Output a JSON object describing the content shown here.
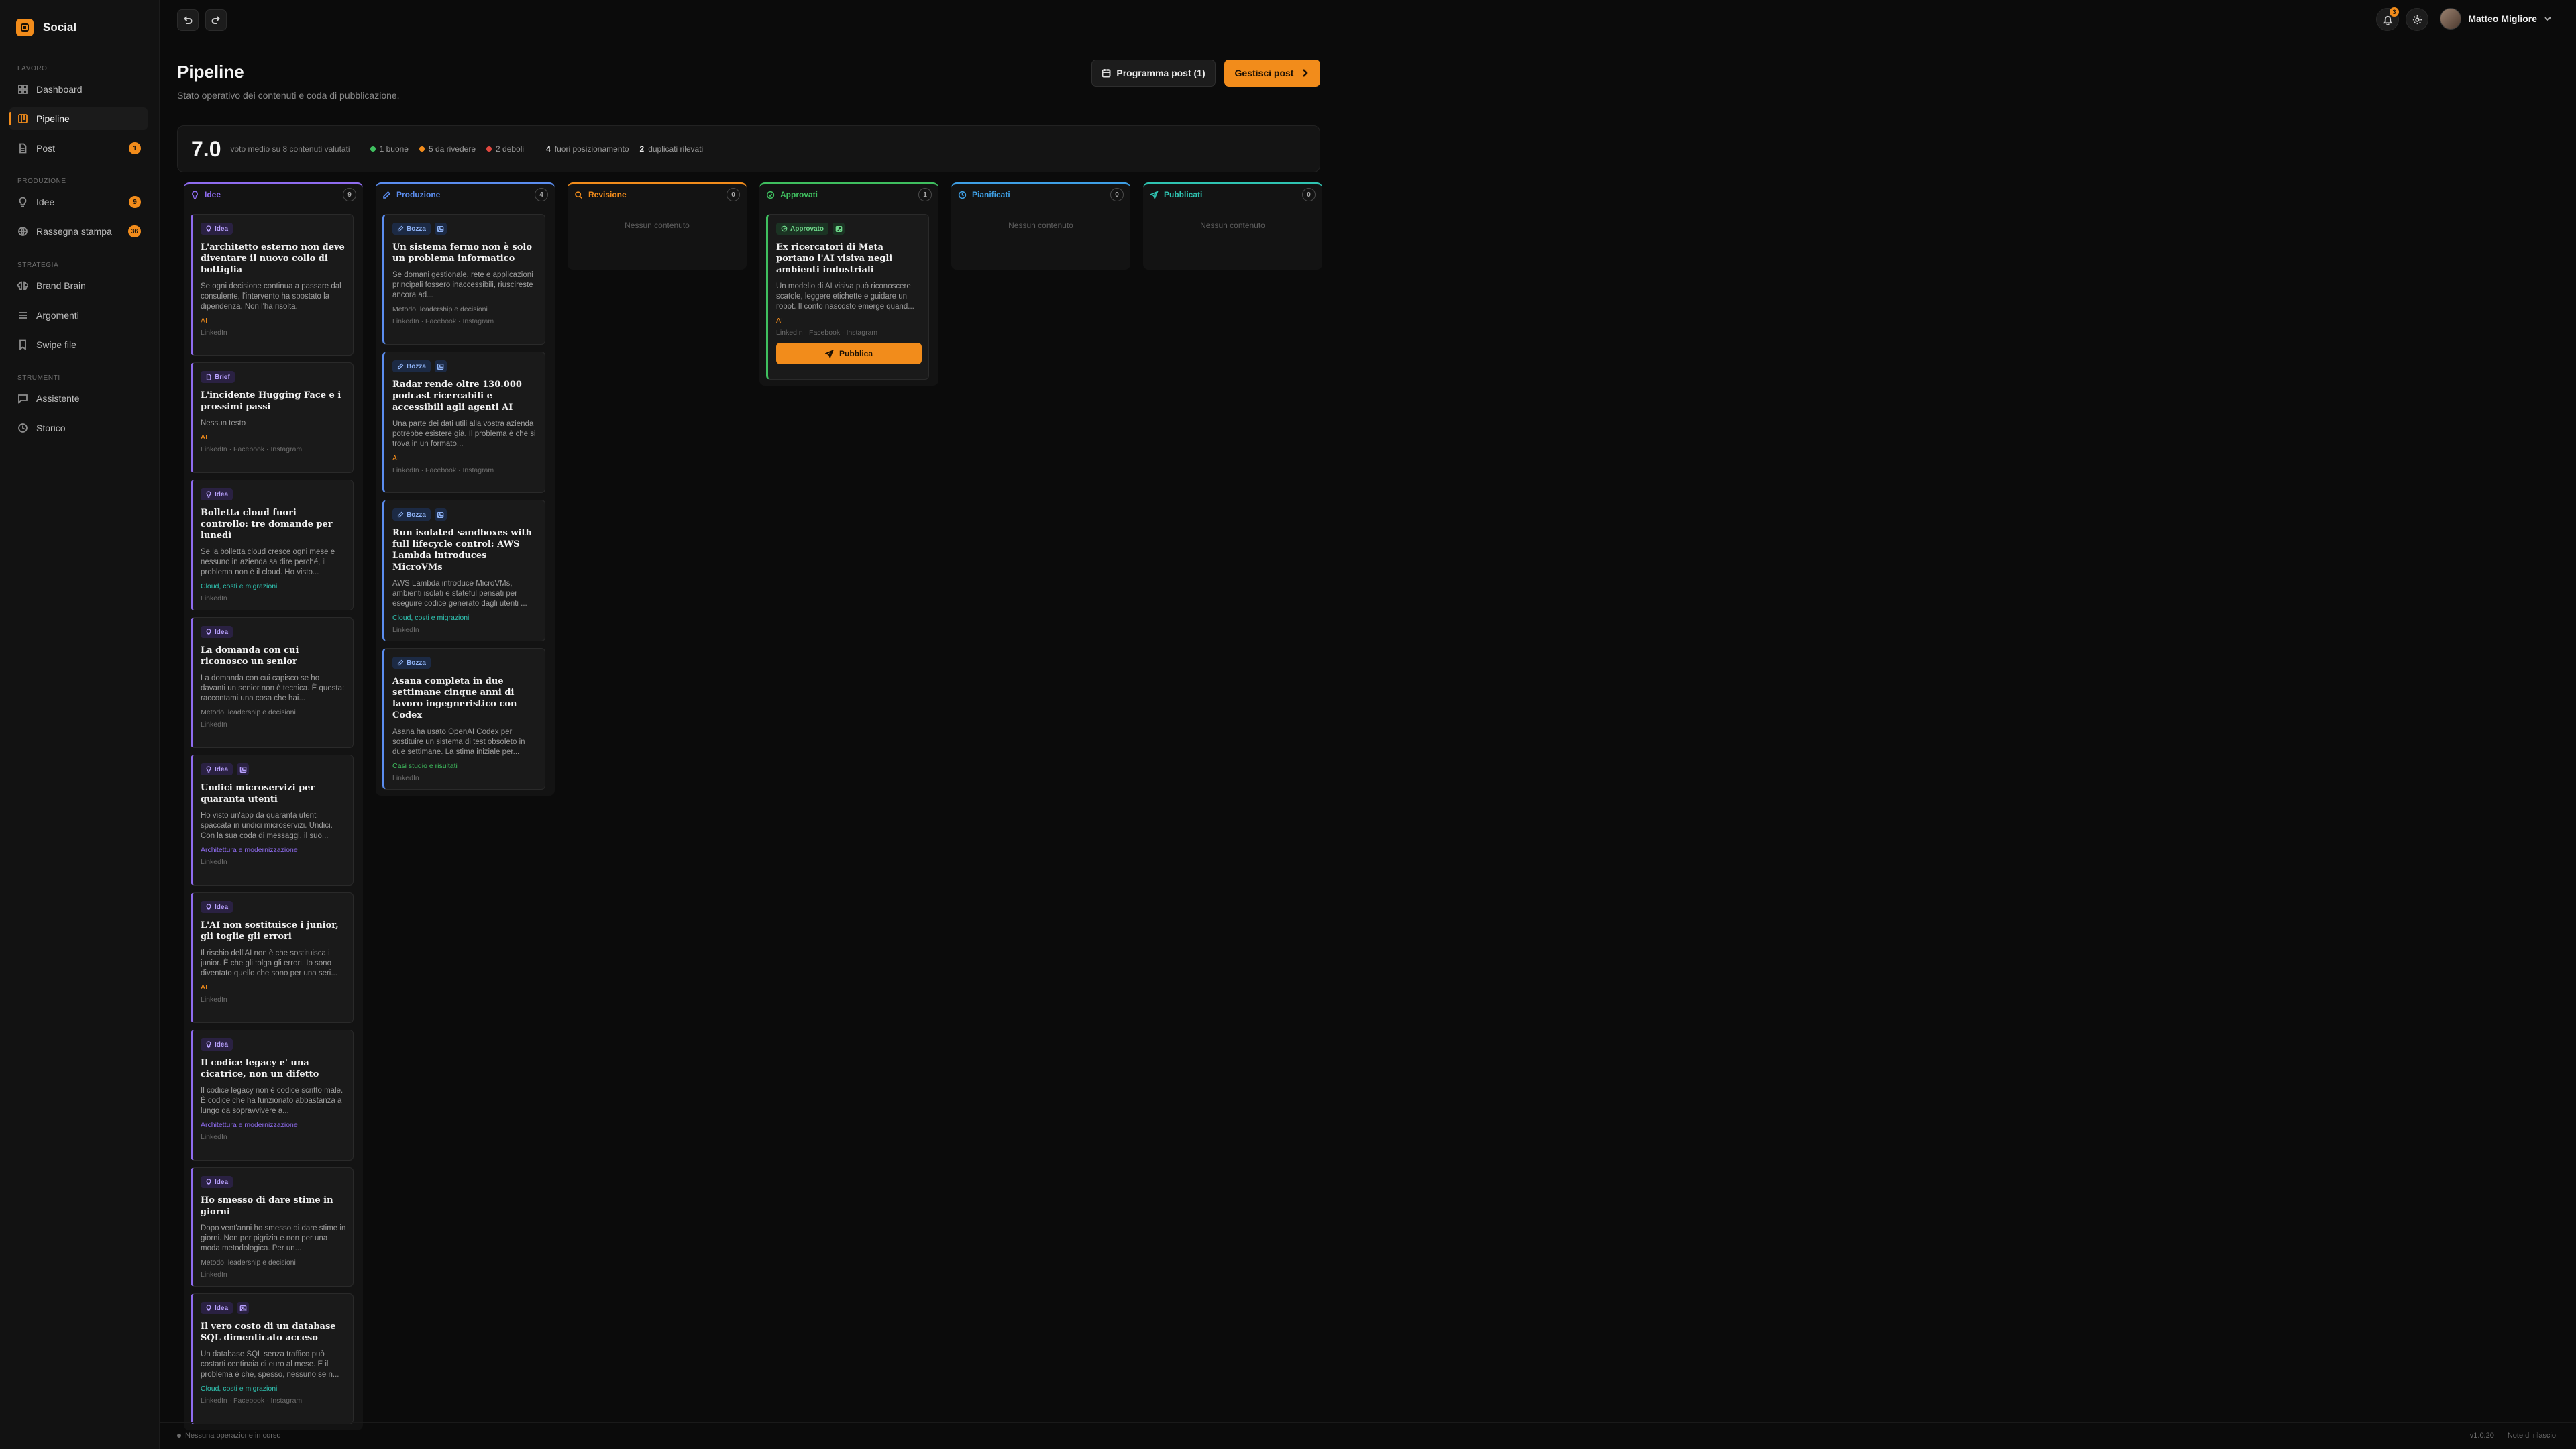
{
  "app": {
    "name": "Social"
  },
  "sidebar": {
    "sections": [
      {
        "title": "LAVORO",
        "items": [
          {
            "label": "Dashboard",
            "icon": "grid-icon",
            "active": false
          },
          {
            "label": "Pipeline",
            "icon": "kanban-icon",
            "active": true
          },
          {
            "label": "Post",
            "icon": "document-icon",
            "active": false,
            "badge": "1"
          }
        ]
      },
      {
        "title": "PRODUZIONE",
        "items": [
          {
            "label": "Idee",
            "icon": "lightbulb-icon",
            "active": false,
            "badge": "9"
          },
          {
            "label": "Rassegna stampa",
            "icon": "globe-icon",
            "active": false,
            "badge": "36"
          }
        ]
      },
      {
        "title": "STRATEGIA",
        "items": [
          {
            "label": "Brand Brain",
            "icon": "brain-icon",
            "active": false
          },
          {
            "label": "Argomenti",
            "icon": "list-icon",
            "active": false
          },
          {
            "label": "Swipe file",
            "icon": "bookmark-icon",
            "active": false
          }
        ]
      },
      {
        "title": "STRUMENTI",
        "items": [
          {
            "label": "Assistente",
            "icon": "chat-icon",
            "active": false
          },
          {
            "label": "Storico",
            "icon": "history-icon",
            "active": false
          }
        ]
      }
    ]
  },
  "topbar": {
    "notifications": "3",
    "user_name": "Matteo Migliore"
  },
  "header": {
    "title": "Pipeline",
    "subtitle": "Stato operativo dei contenuti e coda di pubblicazione.",
    "schedule_label": "Programma post (1)",
    "manage_label": "Gestisci post"
  },
  "stats": {
    "score": "7.0",
    "score_desc": "voto medio su 8 contenuti valutati",
    "good": "1 buone",
    "review": "5 da rivedere",
    "weak": "2 deboli",
    "off_pos_count": "4",
    "off_pos_label": "fuori posizionamento",
    "dup_count": "2",
    "dup_label": "duplicati rilevati",
    "colors": {
      "good": "#3fbf5f",
      "review": "#f28c1b",
      "weak": "#e0473e"
    }
  },
  "columns": [
    {
      "key": "idee",
      "title": "Idee",
      "count": "9",
      "color": "#8f6cf0",
      "icon": "lightbulb-icon"
    },
    {
      "key": "produzione",
      "title": "Produzione",
      "count": "4",
      "color": "#5b8def",
      "icon": "pencil-icon"
    },
    {
      "key": "revisione",
      "title": "Revisione",
      "count": "0",
      "color": "#f28c1b",
      "icon": "search-icon",
      "empty": "Nessun contenuto"
    },
    {
      "key": "approvati",
      "title": "Approvati",
      "count": "1",
      "color": "#3fbf5f",
      "icon": "check-circle-icon"
    },
    {
      "key": "pianificati",
      "title": "Pianificati",
      "count": "0",
      "color": "#3fa0e6",
      "icon": "clock-icon",
      "empty": "Nessun contenuto"
    },
    {
      "key": "pubblicati",
      "title": "Pubblicati",
      "count": "0",
      "color": "#2fc4b2",
      "icon": "send-icon",
      "empty": "Nessun contenuto"
    }
  ],
  "cards": {
    "idee": [
      {
        "tag": "Idea",
        "title": "L'architetto esterno non deve diventare il nuovo collo di bottiglia",
        "body": "Se ogni decisione continua a passare dal consulente, l'intervento ha spostato la dipendenza. Non l'ha risolta.",
        "topic": "AI",
        "channels": "LinkedIn"
      },
      {
        "tag": "Brief",
        "title": "L'incidente Hugging Face e i prossimi passi",
        "body": "Nessun testo",
        "topic": "AI",
        "channels": "LinkedIn · Facebook · Instagram"
      },
      {
        "tag": "Idea",
        "title": "Bolletta cloud fuori controllo: tre domande per lunedì",
        "body": "Se la bolletta cloud cresce ogni mese e nessuno in azienda sa dire perché, il problema non è il cloud. Ho visto...",
        "topic": "Cloud, costi e migrazioni",
        "channels": "LinkedIn"
      },
      {
        "tag": "Idea",
        "title": "La domanda con cui riconosco un senior",
        "body": "La domanda con cui capisco se ho davanti un senior non è tecnica. È questa: raccontami una cosa che hai...",
        "topic": "Metodo, leadership e decisioni",
        "channels": "LinkedIn"
      },
      {
        "tag": "Idea",
        "title": "Undici microservizi per quaranta utenti",
        "body": "Ho visto un'app da quaranta utenti spaccata in undici microservizi. Undici. Con la sua coda di messaggi, il suo...",
        "topic": "Architettura e modernizzazione",
        "channels": "LinkedIn",
        "image": true
      },
      {
        "tag": "Idea",
        "title": "L'AI non sostituisce i junior, gli toglie gli errori",
        "body": "Il rischio dell'AI non è che sostituisca i junior. È che gli tolga gli errori. Io sono diventato quello che sono per una seri...",
        "topic": "AI",
        "channels": "LinkedIn"
      },
      {
        "tag": "Idea",
        "title": "Il codice legacy e' una cicatrice, non un difetto",
        "body": "Il codice legacy non è codice scritto male. È codice che ha funzionato abbastanza a lungo da sopravvivere a...",
        "topic": "Architettura e modernizzazione",
        "channels": "LinkedIn"
      },
      {
        "tag": "Idea",
        "title": "Ho smesso di dare stime in giorni",
        "body": "Dopo vent'anni ho smesso di dare stime in giorni. Non per pigrizia e non per una moda metodologica. Per un...",
        "topic": "Metodo, leadership e decisioni",
        "channels": "LinkedIn"
      },
      {
        "tag": "Idea",
        "title": "Il vero costo di un database SQL dimenticato acceso",
        "body": "Un database SQL senza traffico può costarti centinaia di euro al mese. E il problema è che, spesso, nessuno se n...",
        "topic": "Cloud, costi e migrazioni",
        "channels": "LinkedIn · Facebook · Instagram",
        "image": true
      }
    ],
    "produzione": [
      {
        "tag": "Bozza",
        "title": "Un sistema fermo non è solo un problema informatico",
        "body": "Se domani gestionale, rete e applicazioni principali fossero inaccessibili, riuscireste ancora ad...",
        "topic": "Metodo, leadership e decisioni",
        "channels": "LinkedIn · Facebook · Instagram",
        "image": true
      },
      {
        "tag": "Bozza",
        "title": "Radar rende oltre 130.000 podcast ricercabili e accessibili agli agenti AI",
        "body": "Una parte dei dati utili alla vostra azienda potrebbe esistere già. Il problema è che si trova in un formato...",
        "topic": "AI",
        "channels": "LinkedIn · Facebook · Instagram",
        "image": true
      },
      {
        "tag": "Bozza",
        "title": "Run isolated sandboxes with full lifecycle control: AWS Lambda introduces MicroVMs",
        "body": "AWS Lambda introduce MicroVMs, ambienti isolati e stateful pensati per eseguire codice generato dagli utenti ...",
        "topic": "Cloud, costi e migrazioni",
        "channels": "LinkedIn",
        "image": true
      },
      {
        "tag": "Bozza",
        "title": "Asana completa in due settimane cinque anni di lavoro ingegneristico con Codex",
        "body": "Asana ha usato OpenAI Codex per sostituire un sistema di test obsoleto in due settimane. La stima iniziale per...",
        "topic": "Casi studio e risultati",
        "channels": "LinkedIn"
      }
    ],
    "approvati": [
      {
        "tag": "Approvato",
        "title": "Ex ricercatori di Meta portano l'AI visiva negli ambienti industriali",
        "body": "Un modello di AI visiva può riconoscere scatole, leggere etichette e guidare un robot. Il conto nascosto emerge quand...",
        "topic": "AI",
        "channels": "LinkedIn · Facebook · Instagram",
        "image": true,
        "action": "Pubblica"
      }
    ]
  },
  "topic_colors": {
    "AI": "#f28c1b",
    "Cloud, costi e migrazioni": "#2fc4b2",
    "Metodo, leadership e decisioni": "#8a8a8a",
    "Architettura e modernizzazione": "#8f6cf0",
    "Casi studio e risultati": "#3fbf5f"
  },
  "footer": {
    "status": "Nessuna operazione in corso",
    "version": "v1.0.20",
    "notes": "Note di rilascio"
  }
}
